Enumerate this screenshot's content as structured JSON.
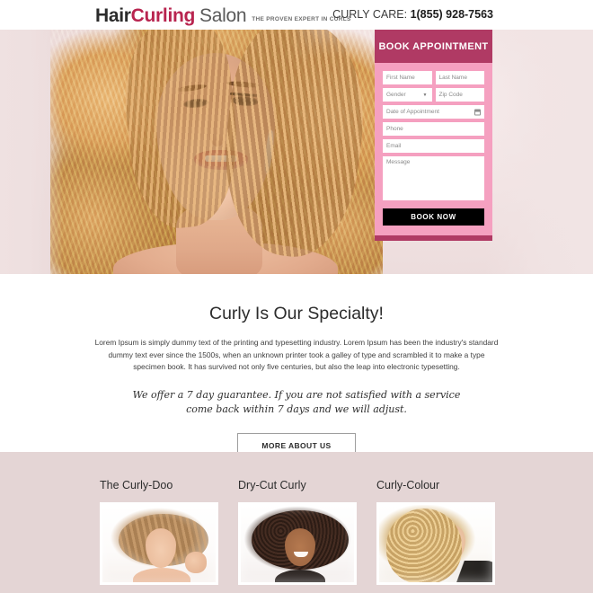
{
  "header": {
    "logo_hair": "Hair",
    "logo_curling": "Curling",
    "logo_salon": "Salon",
    "tagline": "THE PROVEN EXPERT IN CURLS",
    "care_label": "CURLY CARE:",
    "phone": "1(855) 928-7563"
  },
  "form": {
    "heading": "BOOK APPOINTMENT",
    "first_name_placeholder": "First Name",
    "last_name_placeholder": "Last Name",
    "gender_placeholder": "Gender",
    "zip_placeholder": "Zip Code",
    "date_placeholder": "Date of Appointment",
    "phone_placeholder": "Phone",
    "email_placeholder": "Email",
    "message_placeholder": "Message",
    "submit_label": "BOOK NOW"
  },
  "about": {
    "title": "Curly Is Our Specialty!",
    "paragraph": "Lorem Ipsum is simply dummy text of the printing and typesetting industry. Lorem Ipsum has been the industry's standard dummy text ever since the 1500s, when an unknown printer took a galley of type and scrambled it to make a type specimen book. It has survived not only five centuries, but also the leap into electronic typesetting.",
    "guarantee": "We offer a 7 day guarantee. If you are not satisfied with a service come back within 7 days and we will adjust.",
    "button_label": "MORE ABOUT US"
  },
  "services": [
    {
      "title": "The Curly-Doo"
    },
    {
      "title": "Dry-Cut Curly"
    },
    {
      "title": "Curly-Colour"
    }
  ],
  "colors": {
    "brand_magenta": "#b03a64",
    "panel_pink": "#f5a0c0",
    "accent_red": "#b8244f",
    "hero_bg": "#efe1e1",
    "services_bg": "#e4d5d5",
    "button_black": "#000000"
  }
}
